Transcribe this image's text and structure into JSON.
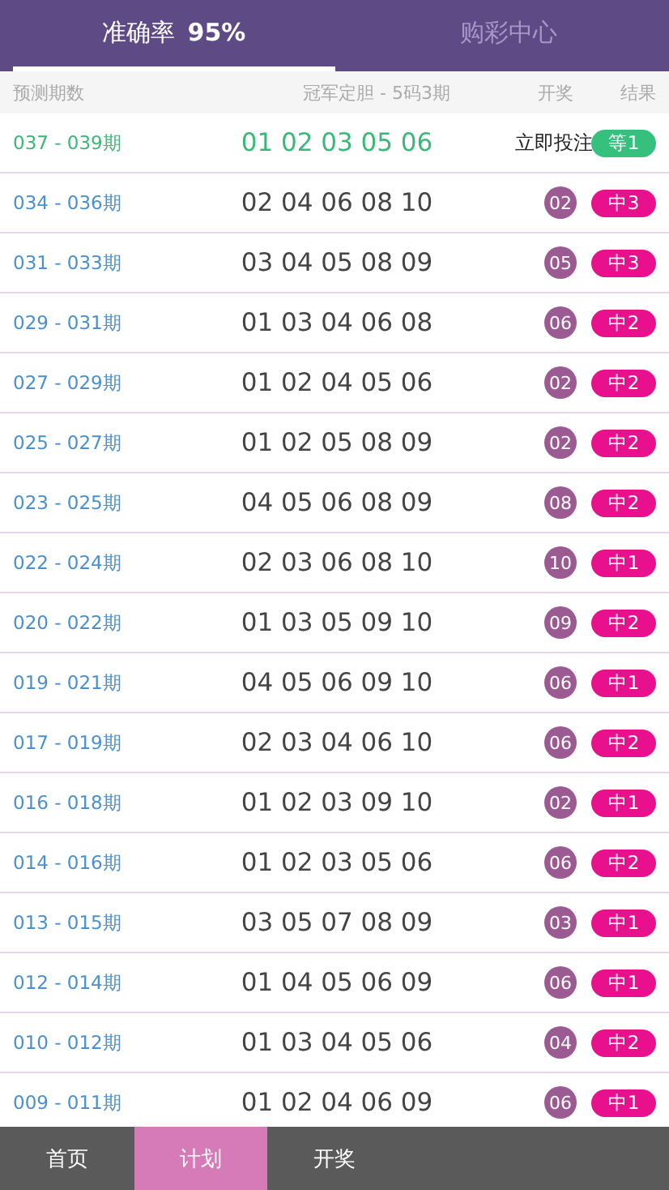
{
  "header_tabs": [
    {
      "label": "准确率",
      "value": "95%",
      "selected": true
    },
    {
      "label": "购彩中心",
      "selected": false
    }
  ],
  "table": {
    "columns": [
      "预测期数",
      "冠军定胆 - 5码3期",
      "开奖",
      "结果"
    ],
    "rows": [
      {
        "kind": "current",
        "period": "037 - 039期",
        "numbers": "01 02 03 05 06",
        "action": "立即投注",
        "result": "等1"
      },
      {
        "kind": "past",
        "period": "034 - 036期",
        "numbers": "02 04 06 08 10",
        "draw": "02",
        "result": "中3"
      },
      {
        "kind": "past",
        "period": "031 - 033期",
        "numbers": "03 04 05 08 09",
        "draw": "05",
        "result": "中3"
      },
      {
        "kind": "past",
        "period": "029 - 031期",
        "numbers": "01 03 04 06 08",
        "draw": "06",
        "result": "中2"
      },
      {
        "kind": "past",
        "period": "027 - 029期",
        "numbers": "01 02 04 05 06",
        "draw": "02",
        "result": "中2"
      },
      {
        "kind": "past",
        "period": "025 - 027期",
        "numbers": "01 02 05 08 09",
        "draw": "02",
        "result": "中2"
      },
      {
        "kind": "past",
        "period": "023 - 025期",
        "numbers": "04 05 06 08 09",
        "draw": "08",
        "result": "中2"
      },
      {
        "kind": "past",
        "period": "022 - 024期",
        "numbers": "02 03 06 08 10",
        "draw": "10",
        "result": "中1"
      },
      {
        "kind": "past",
        "period": "020 - 022期",
        "numbers": "01 03 05 09 10",
        "draw": "09",
        "result": "中2"
      },
      {
        "kind": "past",
        "period": "019 - 021期",
        "numbers": "04 05 06 09 10",
        "draw": "06",
        "result": "中1"
      },
      {
        "kind": "past",
        "period": "017 - 019期",
        "numbers": "02 03 04 06 10",
        "draw": "06",
        "result": "中2"
      },
      {
        "kind": "past",
        "period": "016 - 018期",
        "numbers": "01 02 03 09 10",
        "draw": "02",
        "result": "中1"
      },
      {
        "kind": "past",
        "period": "014 - 016期",
        "numbers": "01 02 03 05 06",
        "draw": "06",
        "result": "中2"
      },
      {
        "kind": "past",
        "period": "013 - 015期",
        "numbers": "03 05 07 08 09",
        "draw": "03",
        "result": "中1"
      },
      {
        "kind": "past",
        "period": "012 - 014期",
        "numbers": "01 04 05 06 09",
        "draw": "06",
        "result": "中1"
      },
      {
        "kind": "past",
        "period": "010 - 012期",
        "numbers": "01 03 04 05 06",
        "draw": "04",
        "result": "中2"
      },
      {
        "kind": "past",
        "period": "009 - 011期",
        "numbers": "01 02 04 06 09",
        "draw": "06",
        "result": "中1"
      }
    ]
  },
  "bottom_nav": [
    {
      "label": "首页",
      "selected": false
    },
    {
      "label": "计划",
      "selected": true
    },
    {
      "label": "开奖",
      "selected": false
    }
  ]
}
